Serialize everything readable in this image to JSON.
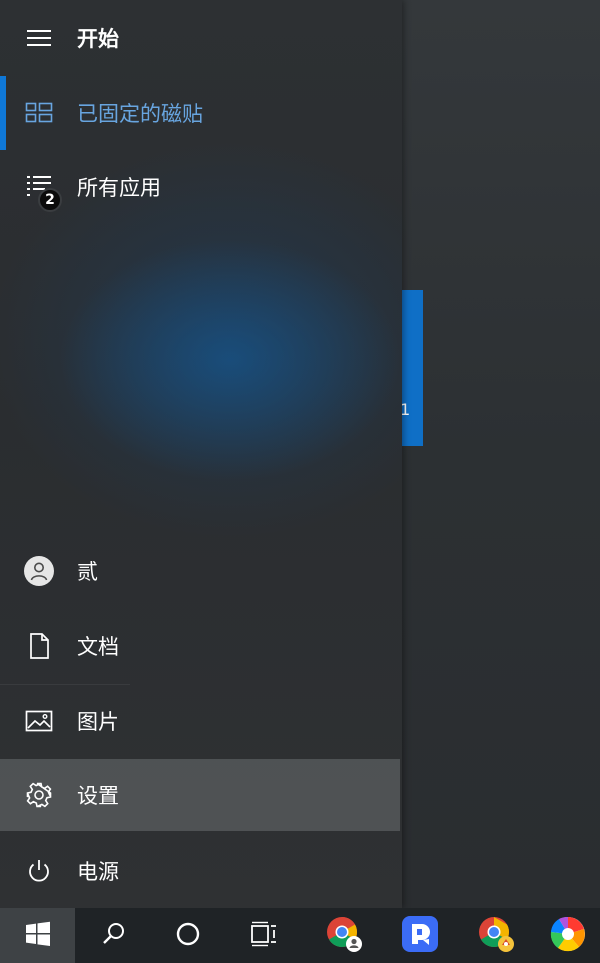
{
  "start_menu": {
    "header": {
      "label": "开始",
      "icon": "hamburger-menu-icon"
    },
    "nav": {
      "pinned_tiles": {
        "label": "已固定的磁贴",
        "icon": "tiles-icon",
        "selected": true
      },
      "all_apps": {
        "label": "所有应用",
        "icon": "list-icon",
        "badge": "2"
      }
    },
    "bottom": {
      "user": {
        "label": "贰",
        "icon": "user-avatar-icon"
      },
      "documents": {
        "label": "文档",
        "icon": "document-icon"
      },
      "pictures": {
        "label": "图片",
        "icon": "picture-icon"
      },
      "settings": {
        "label": "设置",
        "icon": "gear-icon",
        "hovered": true
      },
      "power": {
        "label": "电源",
        "icon": "power-icon"
      }
    }
  },
  "desktop": {
    "tile_glyph": "1"
  },
  "taskbar": {
    "items": [
      {
        "name": "start",
        "icon": "windows-logo-icon"
      },
      {
        "name": "search",
        "icon": "search-icon"
      },
      {
        "name": "cortana",
        "icon": "cortana-circle-icon"
      },
      {
        "name": "task-view",
        "icon": "task-view-icon"
      },
      {
        "name": "chrome-profile",
        "icon": "chrome-icon"
      },
      {
        "name": "docs-app",
        "icon": "docs-app-icon"
      },
      {
        "name": "chrome-second-profile",
        "icon": "chrome-icon"
      },
      {
        "name": "pinwheel-app",
        "icon": "pinwheel-icon"
      }
    ]
  },
  "colors": {
    "accent": "#0f78d7",
    "selected_text": "#68a5e0",
    "tile": "#0f6fc6",
    "taskbar": "#1f2326",
    "hover": "#5d6163"
  }
}
